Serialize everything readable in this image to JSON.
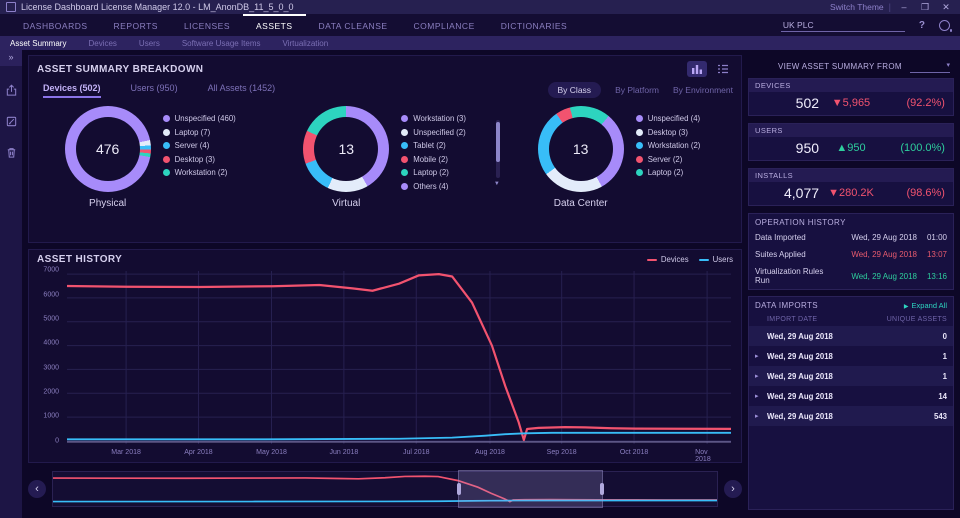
{
  "window": {
    "title": "License Dashboard License Manager 12.0 - LM_AnonDB_11_5_0_0",
    "switch_theme": "Switch Theme",
    "minimize": "–",
    "maximize": "❒",
    "close": "✕"
  },
  "nav": {
    "items": [
      "DASHBOARDS",
      "REPORTS",
      "LICENSES",
      "ASSETS",
      "DATA CLEANSE",
      "COMPLIANCE",
      "DICTIONARIES"
    ],
    "active": "ASSETS",
    "company": "UK PLC",
    "help": "?"
  },
  "subtabs": {
    "items": [
      "Asset Summary",
      "Devices",
      "Users",
      "Software Usage Items",
      "Virtualization"
    ],
    "active": "Asset Summary"
  },
  "breakdown": {
    "title": "ASSET SUMMARY BREAKDOWN",
    "tabs": [
      "Devices (502)",
      "Users (950)",
      "All Assets (1452)"
    ],
    "active_tab": "Devices (502)",
    "filters": [
      "By Class",
      "By Platform",
      "By Environment"
    ],
    "active_filter": "By Class",
    "donuts": [
      {
        "label": "Physical",
        "total": "476",
        "from": 0,
        "scrollbar": false,
        "segments": [
          {
            "color": "#a78bfa",
            "deg": 78
          },
          {
            "color": "#e3ecfa",
            "deg": 7
          },
          {
            "color": "#38bdf8",
            "deg": 6
          },
          {
            "color": "#f2536f",
            "deg": 5
          },
          {
            "color": "#2dd4bf",
            "deg": 5
          },
          {
            "color": "#a78bfa",
            "deg": 259
          }
        ],
        "legend": [
          {
            "name": "Unspecified (460)",
            "color": "#a78bfa"
          },
          {
            "name": "Laptop (7)",
            "color": "#e3ecfa"
          },
          {
            "name": "Server (4)",
            "color": "#38bdf8"
          },
          {
            "name": "Desktop (3)",
            "color": "#f2536f"
          },
          {
            "name": "Workstation (2)",
            "color": "#2dd4bf"
          }
        ]
      },
      {
        "label": "Virtual",
        "total": "13",
        "from": 0,
        "scrollbar": true,
        "segments": [
          {
            "color": "#a78bfa",
            "deg": 150
          },
          {
            "color": "#e3ecfa",
            "deg": 55
          },
          {
            "color": "#38bdf8",
            "deg": 45
          },
          {
            "color": "#f2536f",
            "deg": 45
          },
          {
            "color": "#2dd4bf",
            "deg": 65
          }
        ],
        "legend": [
          {
            "name": "Workstation (3)",
            "color": "#a78bfa"
          },
          {
            "name": "Unspecified (2)",
            "color": "#e3ecfa"
          },
          {
            "name": "Tablet (2)",
            "color": "#38bdf8"
          },
          {
            "name": "Mobile (2)",
            "color": "#f2536f"
          },
          {
            "name": "Laptop (2)",
            "color": "#2dd4bf"
          },
          {
            "name": "Others (4)",
            "color": "#a78bfa"
          }
        ]
      },
      {
        "label": "Data Center",
        "total": "13",
        "from": -35,
        "scrollbar": false,
        "segments": [
          {
            "color": "#f2536f",
            "deg": 55
          },
          {
            "color": "#2dd4bf",
            "deg": 55
          },
          {
            "color": "#a78bfa",
            "deg": 111
          },
          {
            "color": "#e3ecfa",
            "deg": 83
          },
          {
            "color": "#38bdf8",
            "deg": 56
          }
        ],
        "legend": [
          {
            "name": "Unspecified (4)",
            "color": "#a78bfa"
          },
          {
            "name": "Desktop (3)",
            "color": "#e3ecfa"
          },
          {
            "name": "Workstation (2)",
            "color": "#38bdf8"
          },
          {
            "name": "Server (2)",
            "color": "#f2536f"
          },
          {
            "name": "Laptop (2)",
            "color": "#2dd4bf"
          }
        ]
      }
    ]
  },
  "history_panel": {
    "title": "ASSET HISTORY"
  },
  "chart_data": {
    "type": "line",
    "title": "ASSET HISTORY",
    "x_ticks": [
      "Mar 2018",
      "Apr 2018",
      "May 2018",
      "Jun 2018",
      "Jul 2018",
      "Aug 2018",
      "Sep 2018",
      "Oct 2018",
      "Nov 2018"
    ],
    "x_tick_pct": [
      8.9,
      19.8,
      30.8,
      41.7,
      52.6,
      63.7,
      74.5,
      85.4,
      96.4
    ],
    "y_ticks": [
      0,
      1000,
      2000,
      3000,
      4000,
      5000,
      6000,
      7000
    ],
    "ylim": [
      0,
      7000
    ],
    "grid": true,
    "legend_position": "top-right",
    "series": [
      {
        "name": "Devices",
        "color": "#f2536f",
        "points": [
          [
            0,
            6500
          ],
          [
            9,
            6470
          ],
          [
            20,
            6460
          ],
          [
            31,
            6490
          ],
          [
            38,
            6540
          ],
          [
            43,
            6400
          ],
          [
            46,
            6300
          ],
          [
            50,
            6600
          ],
          [
            53,
            6950
          ],
          [
            56,
            7000
          ],
          [
            58,
            6900
          ],
          [
            61,
            5800
          ],
          [
            64,
            4000
          ],
          [
            66,
            2300
          ],
          [
            68,
            800
          ],
          [
            68.8,
            40
          ],
          [
            69.3,
            500
          ],
          [
            71,
            550
          ],
          [
            75,
            580
          ],
          [
            78,
            565
          ],
          [
            82,
            530
          ],
          [
            86,
            515
          ],
          [
            92,
            508
          ],
          [
            100,
            505
          ]
        ]
      },
      {
        "name": "Users",
        "color": "#38bdf8",
        "points": [
          [
            0,
            70
          ],
          [
            30,
            70
          ],
          [
            50,
            90
          ],
          [
            58,
            140
          ],
          [
            63,
            220
          ],
          [
            66,
            280
          ],
          [
            69,
            320
          ],
          [
            73,
            340
          ],
          [
            100,
            340
          ]
        ]
      }
    ]
  },
  "scrubber": {
    "selection_start_pct": 61,
    "selection_end_pct": 82.5
  },
  "sidebar": {
    "view_from_label": "VIEW ASSET SUMMARY FROM",
    "stats": [
      {
        "label": "DEVICES",
        "value": "502",
        "arrow": "▼",
        "delta": "5,965",
        "pct": "(92.2%)",
        "trend": "down"
      },
      {
        "label": "USERS",
        "value": "950",
        "arrow": "▲",
        "delta": "950",
        "pct": "(100.0%)",
        "trend": "up"
      },
      {
        "label": "INSTALLS",
        "value": "4,077",
        "arrow": "▼",
        "delta": "280.2K",
        "pct": "(98.6%)",
        "trend": "down"
      }
    ],
    "operation_history": {
      "title": "OPERATION HISTORY",
      "rows": [
        {
          "name": "Data Imported",
          "date": "Wed, 29 Aug 2018",
          "time": "01:00",
          "status": "neutral"
        },
        {
          "name": "Suites Applied",
          "date": "Wed, 29 Aug 2018",
          "time": "13:07",
          "status": "error"
        },
        {
          "name": "Virtualization Rules Run",
          "date": "Wed, 29 Aug 2018",
          "time": "13:16",
          "status": "ok"
        }
      ]
    },
    "data_imports": {
      "title": "DATA IMPORTS",
      "expand_all": "Expand All",
      "columns": [
        "IMPORT DATE",
        "UNIQUE ASSETS"
      ],
      "rows": [
        {
          "date": "Wed, 29 Aug 2018",
          "assets": "0",
          "expandable": false
        },
        {
          "date": "Wed, 29 Aug 2018",
          "assets": "1",
          "expandable": true
        },
        {
          "date": "Wed, 29 Aug 2018",
          "assets": "1",
          "expandable": true
        },
        {
          "date": "Wed, 29 Aug 2018",
          "assets": "14",
          "expandable": true
        },
        {
          "date": "Wed, 29 Aug 2018",
          "assets": "543",
          "expandable": true
        }
      ]
    }
  }
}
